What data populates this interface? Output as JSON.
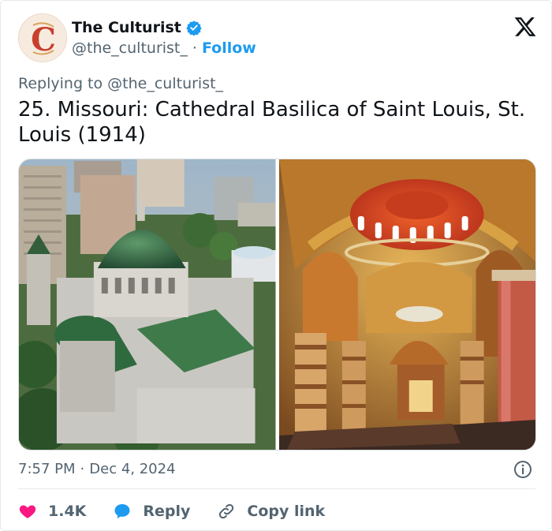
{
  "author": {
    "display_name": "The Culturist",
    "handle": "@the_culturist_",
    "separator": "·",
    "follow_label": "Follow",
    "avatar_letter": "C"
  },
  "reply_context": {
    "prefix": "Replying to",
    "mention": "@the_culturist_"
  },
  "tweet": {
    "text": "25. Missouri: Cathedral Basilica of Saint Louis, St. Louis (1914)"
  },
  "media": [
    {
      "icon": "cathedral-exterior-photo"
    },
    {
      "icon": "cathedral-interior-photo"
    }
  ],
  "meta": {
    "time": "7:57 PM",
    "separator": "·",
    "date": "Dec 4, 2024"
  },
  "actions": {
    "likes": "1.4K",
    "reply_label": "Reply",
    "copy_label": "Copy link"
  },
  "colors": {
    "accent": "#1d9bf0",
    "like": "#f91880",
    "text": "#0f1419",
    "muted": "#536471"
  }
}
